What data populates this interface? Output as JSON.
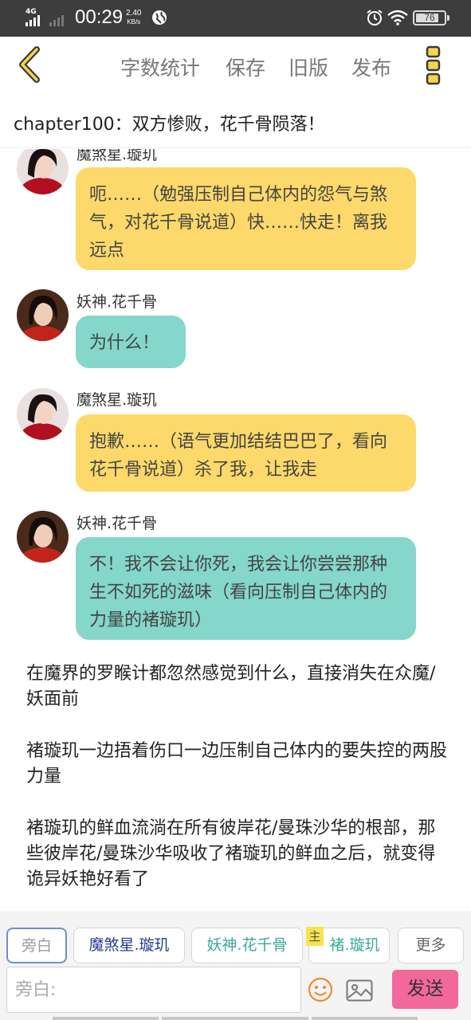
{
  "status_bar": {
    "network": "4G",
    "time": "00:29",
    "speed_value": "2.40",
    "speed_unit": "KB/s",
    "battery": "76"
  },
  "toolbar": {
    "word_count": "字数统计",
    "save": "保存",
    "old_version": "旧版",
    "publish": "发布"
  },
  "chapter_title": "chapter100：双方惨败，花千骨陨落！",
  "messages": [
    {
      "speaker": "魔煞星.璇玑",
      "text": "呃……（勉强压制自己体内的怨气与煞气，对花千骨说道）快……快走！离我远点",
      "color": "yellow"
    },
    {
      "speaker": "妖神.花千骨",
      "text": "为什么！",
      "color": "teal"
    },
    {
      "speaker": "魔煞星.璇玑",
      "text": "抱歉……（语气更加结结巴巴了，看向花千骨说道）杀了我，让我走",
      "color": "yellow"
    },
    {
      "speaker": "妖神.花千骨",
      "text": "不！我不会让你死，我会让你尝尝那种生不如死的滋味（看向压制自己体内的力量的褚璇玑）",
      "color": "teal"
    }
  ],
  "narrations": [
    "在魔界的罗睺计都忽然感觉到什么，直接消失在众魔/妖面前",
    "褚璇玑一边捂着伤口一边压制自己体内的要失控的两股力量",
    "褚璇玑的鲜血流淌在所有彼岸花/曼珠沙华的根部，那些彼岸花/曼珠沙华吸收了褚璇玑的鲜血之后，就变得诡异妖艳好看了"
  ],
  "roles": {
    "narrator": "旁白",
    "role1": "魔煞星.璇玑",
    "role2": "妖神.花千骨",
    "role3": "褚.璇玑",
    "main_badge": "主",
    "more": "更多"
  },
  "input": {
    "placeholder": "旁白:",
    "value": ""
  },
  "send": "发送",
  "colors": {
    "yellow_bubble": "#fcd96a",
    "teal_bubble": "#85d6cb",
    "send_button": "#f2689b",
    "role1_text": "#1f3f8f",
    "role2_text": "#3aa89a",
    "status_bar": "#3d3d3d"
  },
  "icons": [
    "back-chevron-icon",
    "more-menu-icon",
    "emoji-icon",
    "image-icon",
    "alarm-icon",
    "wifi-icon",
    "battery-icon",
    "globe-icon",
    "signal-icon"
  ]
}
